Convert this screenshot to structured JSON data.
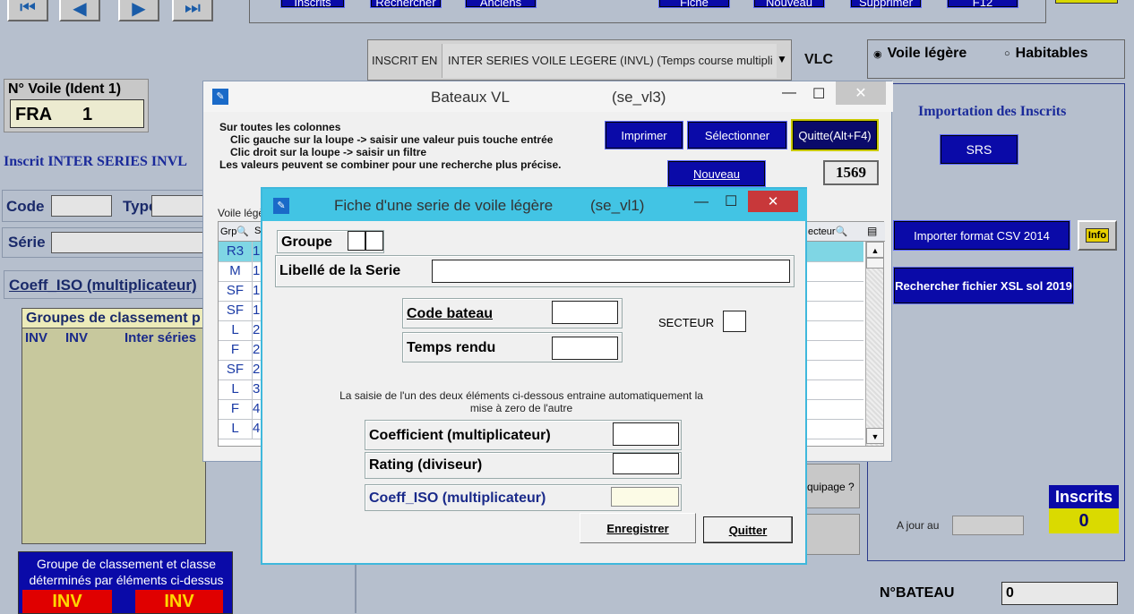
{
  "top_nav": {
    "first": "⏮",
    "prev": "◀",
    "next": "▶",
    "last": "⏭"
  },
  "top_bar": {
    "buttons": [
      "Inscrits",
      "Rechercher",
      "Anciens",
      "Fiche",
      "Nouveau",
      "Supprimer",
      "F12"
    ]
  },
  "inscrit_en": {
    "label": "INSCRIT EN",
    "value": "INTER SERIES VOILE LEGERE (INVL) (Temps course multipli",
    "code": "VLC"
  },
  "type_radio": {
    "option1": "Voile légère",
    "option2": "Habitables"
  },
  "right_panel": {
    "import_title": "Importation des  Inscrits",
    "srs_button": "SRS",
    "csv_button": "Importer format CSV 2014",
    "info_button": "Info",
    "xsl_button": "Rechercher fichier XSL sol 2019",
    "equipage_label": "quipage  ?",
    "a_jour_label": "A jour au",
    "inscrits_label": "Inscrits",
    "inscrits_count": "0",
    "nbateau_label": "N°BATEAU",
    "nbateau_value": "0"
  },
  "left_panel": {
    "voile_label": "N° Voile (Ident 1)",
    "voile_country": "FRA",
    "voile_number": "1",
    "inscrit_text": "Inscrit INTER SERIES  INVL",
    "code_label": "Code",
    "type_label": "Type",
    "serie_label": "Série",
    "coeff_label": "Coeff_ISO (multiplicateur)",
    "groupes_header": "Groupes de classement p",
    "groupes_row": [
      "INV",
      "INV",
      "Inter séries"
    ],
    "groupe_bottom_text": "Groupe de classement  et classe déterminés par éléments ci-dessus",
    "inv1": "INV",
    "inv2": "INV"
  },
  "bateaux_window": {
    "title": "Bateaux  VL",
    "subtitle": "(se_vl3)",
    "help_line1": "Sur toutes les colonnes",
    "help_line2": "Clic gauche sur la loupe -> saisir une valeur puis touche entrée",
    "help_line3": "Clic droit sur la loupe -> saisir un filtre",
    "help_line4": "Les valeurs peuvent se combiner pour une recherche plus précise.",
    "print_button": "Imprimer",
    "select_button": "Sélectionner",
    "quit_button": "Quitte(Alt+F4)",
    "new_button": "Nouveau",
    "count": "1569",
    "grid_caption": "Voile légè",
    "col_grp": "Grp",
    "col_s": "S",
    "col_secteur": "ecteur",
    "rows": [
      {
        "grp": "R3",
        "s": "1"
      },
      {
        "grp": "M",
        "s": "1"
      },
      {
        "grp": "SF",
        "s": "1"
      },
      {
        "grp": "SF",
        "s": "1"
      },
      {
        "grp": "L",
        "s": "2"
      },
      {
        "grp": "F",
        "s": "2"
      },
      {
        "grp": "SF",
        "s": "2"
      },
      {
        "grp": "L",
        "s": "3"
      },
      {
        "grp": "F",
        "s": "4"
      },
      {
        "grp": "L",
        "s": "4"
      }
    ]
  },
  "fiche_window": {
    "title": "Fiche d'une serie de voile légère",
    "subtitle": "(se_vl1)",
    "groupe_label": "Groupe",
    "libelle_label": "Libellé de la Serie",
    "code_bateau_label": "Code bateau",
    "secteur_label": "SECTEUR",
    "temps_rendu_label": "Temps rendu",
    "note": "La saisie de l'un des deux éléments ci-dessous entraine automatiquement la mise à zero de l'autre",
    "coeff_label": "Coefficient (multiplicateur)",
    "rating_label": "Rating (diviseur)",
    "coeff_iso_label": "Coeff_ISO (multiplicateur)",
    "save_button": "Enregistrer",
    "quit_button": "Quitter"
  },
  "colors": {
    "background": "#b6bfcd",
    "blue_button": "#0a0aa8",
    "dialog_border": "#3fb8dc",
    "grid_highlight": "#7fd6e4"
  }
}
